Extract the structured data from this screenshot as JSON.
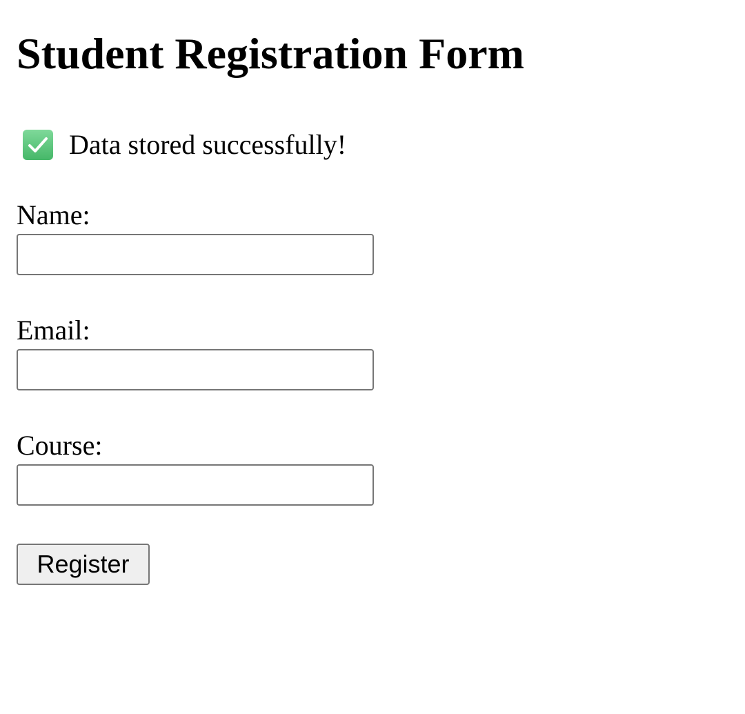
{
  "page": {
    "title": "Student Registration Form"
  },
  "status_message": {
    "icon": "check-mark-icon",
    "text": "Data stored successfully!",
    "icon_color": "#5ac97b"
  },
  "form": {
    "fields": [
      {
        "label": "Name:",
        "value": "",
        "placeholder": ""
      },
      {
        "label": "Email:",
        "value": "",
        "placeholder": ""
      },
      {
        "label": "Course:",
        "value": "",
        "placeholder": ""
      }
    ],
    "submit_label": "Register"
  }
}
